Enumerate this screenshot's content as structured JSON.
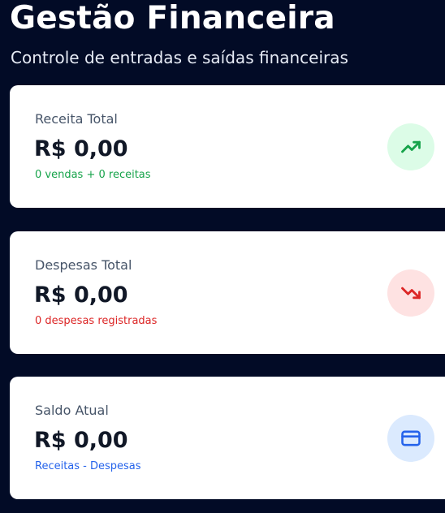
{
  "header": {
    "title": "Gestão Financeira",
    "subtitle": "Controle de entradas e saídas financeiras"
  },
  "cards": [
    {
      "label": "Receita Total",
      "value": "R$ 0,00",
      "detail": "0 vendas + 0 receitas",
      "icon": "trending-up-icon",
      "accent_color": "#16a34a",
      "icon_bg": "#dcfce7"
    },
    {
      "label": "Despesas Total",
      "value": "R$ 0,00",
      "detail": "0 despesas registradas",
      "icon": "trending-down-icon",
      "accent_color": "#dc2626",
      "icon_bg": "#fee2e2"
    },
    {
      "label": "Saldo Atual",
      "value": "R$ 0,00",
      "detail": "Receitas - Despesas",
      "icon": "credit-card-icon",
      "accent_color": "#2563eb",
      "icon_bg": "#dbeafe"
    }
  ]
}
